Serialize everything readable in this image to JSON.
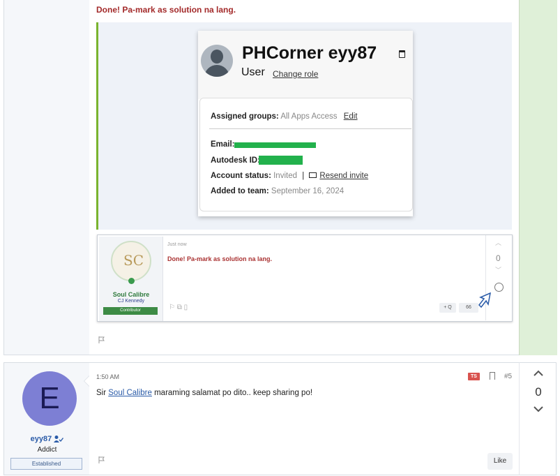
{
  "post1": {
    "message": "Done! Pa-mark as solution na lang.",
    "card": {
      "name": "PHCorner eyy87",
      "role": "User",
      "change_role": "Change role",
      "assigned_groups_label": "Assigned groups:",
      "assigned_groups_value": "All Apps Access",
      "edit_label": "Edit",
      "email_label": "Email:",
      "autodesk_label": "Autodesk ID:",
      "status_label": "Account status:",
      "status_value": "Invited",
      "separator": "|",
      "resend_label": "Resend invite",
      "added_label": "Added to team:",
      "added_value": "September 16, 2024"
    },
    "embed": {
      "user_name": "Soul Calibre",
      "user_subtitle": "CJ Kennedy",
      "user_badge": "Contributor",
      "time": "Just now",
      "message": "Done! Pa-mark as solution na lang.",
      "vote_count": "0",
      "quote_btn": "+ Q",
      "reply_btn": "66"
    }
  },
  "post2": {
    "user": {
      "avatar_letter": "E",
      "name": "eyy87",
      "title": "Addict",
      "badge": "Established"
    },
    "time": "1:50 AM",
    "ts_badge": "TS",
    "post_number": "#5",
    "message_prefix": "Sir ",
    "mention": "Soul Calibre",
    "message_suffix": " maraming salamat po dito.. keep sharing po!",
    "like_label": "Like",
    "vote_count": "0"
  },
  "colors": {
    "accent_red": "#a32a2a",
    "quote_border": "#7ab32e",
    "vote_green": "#dff0d8",
    "redaction": "#22b14c",
    "avatar_purple": "#7d7fd4"
  }
}
